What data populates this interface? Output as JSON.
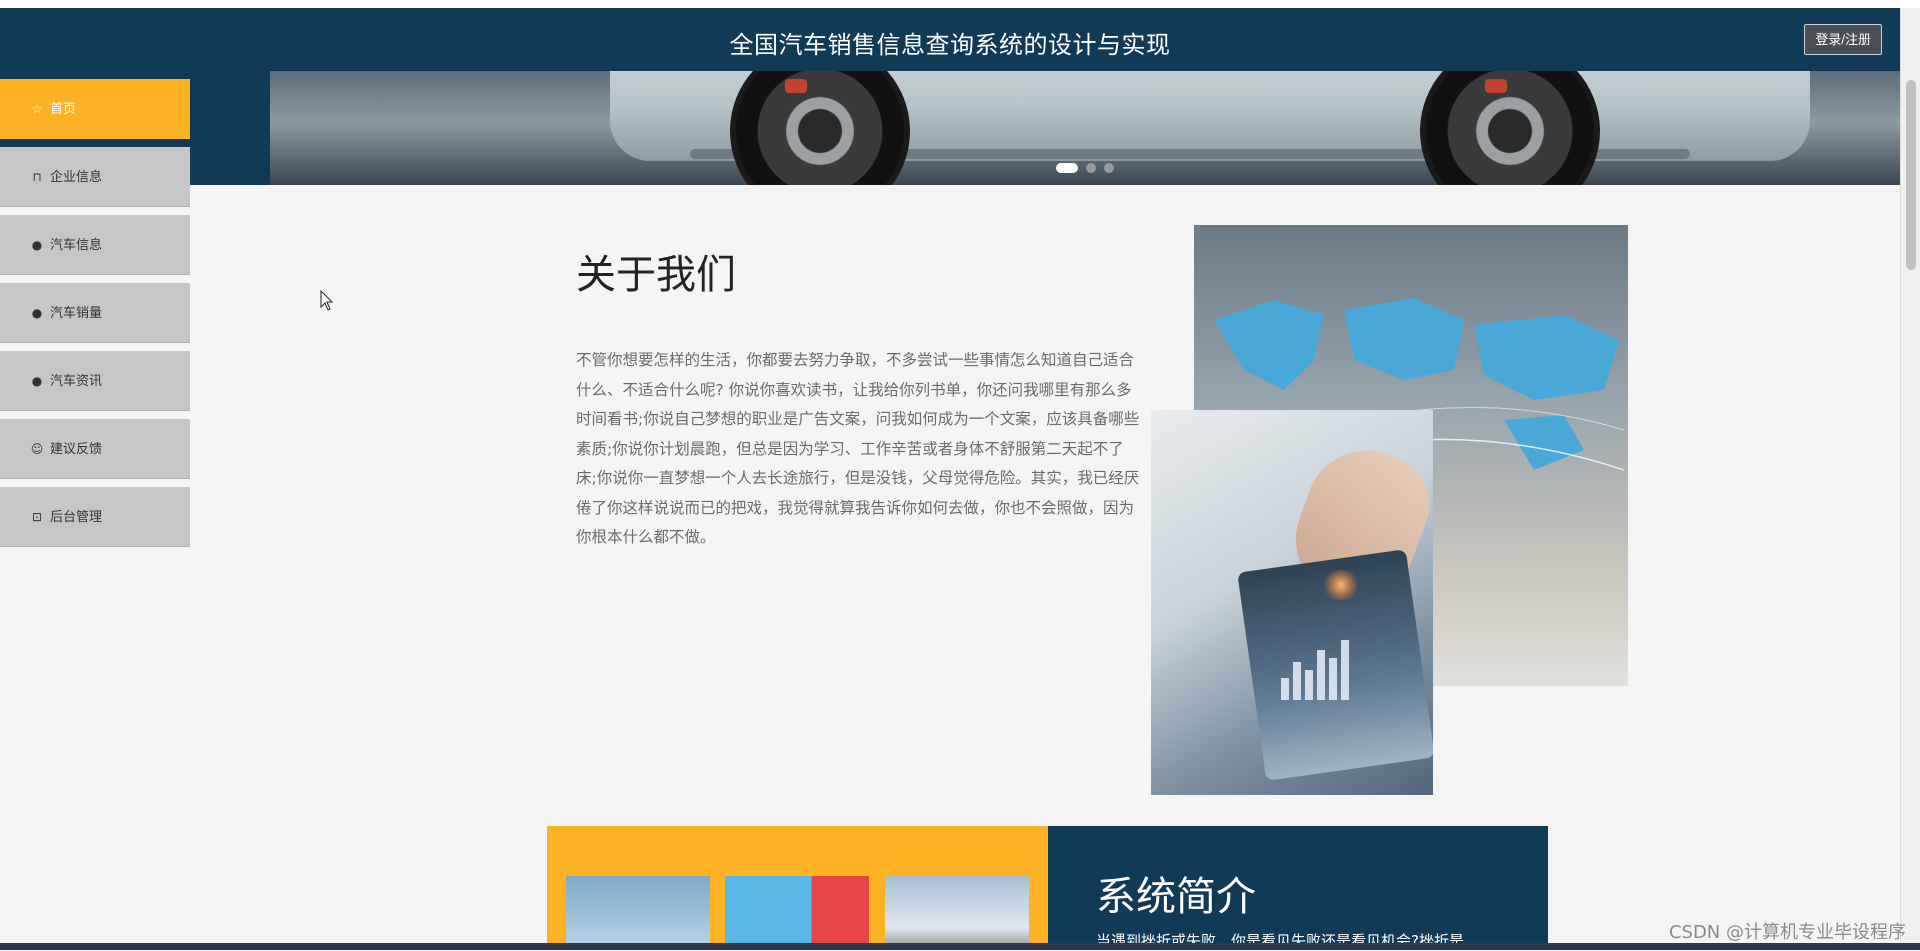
{
  "header": {
    "title": "全国汽车销售信息查询系统的设计与实现",
    "login_label": "登录/注册"
  },
  "banner": {
    "slides": 3,
    "active_slide": 1
  },
  "sidebar": {
    "items": [
      {
        "label": "首页",
        "icon": "star-icon",
        "active": true
      },
      {
        "label": "企业信息",
        "icon": "lock-icon",
        "active": false
      },
      {
        "label": "汽车信息",
        "icon": "info-icon",
        "active": false
      },
      {
        "label": "汽车销量",
        "icon": "question-icon",
        "active": false
      },
      {
        "label": "汽车资讯",
        "icon": "info-icon",
        "active": false
      },
      {
        "label": "建议反馈",
        "icon": "smile-icon",
        "active": false
      },
      {
        "label": "后台管理",
        "icon": "briefcase-icon",
        "active": false
      }
    ]
  },
  "about": {
    "title": "关于我们",
    "text": "不管你想要怎样的生活，你都要去努力争取，不多尝试一些事情怎么知道自己适合什么、不适合什么呢? 你说你喜欢读书，让我给你列书单，你还问我哪里有那么多时间看书;你说自己梦想的职业是广告文案，问我如何成为一个文案，应该具备哪些素质;你说你计划晨跑，但总是因为学习、工作辛苦或者身体不舒服第二天起不了床;你说你一直梦想一个人去长途旅行，但是没钱，父母觉得危险。其实，我已经厌倦了你这样说说而已的把戏，我觉得就算我告诉你如何去做，你也不会照做，因为你根本什么都不做。"
  },
  "intro": {
    "title": "系统简介",
    "text": "当遇到挫折或失败，你是看见失败还是看见机会?挫折是"
  },
  "watermark": "CSDN @计算机专业毕设程序",
  "colors": {
    "navy": "#113a57",
    "accent": "#fdb125",
    "sidebar_bg": "#c6c6c6"
  }
}
